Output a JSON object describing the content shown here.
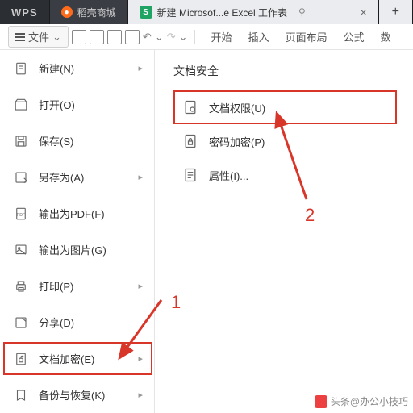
{
  "titlebar": {
    "wps": "WPS",
    "doko": "稻壳商城",
    "doc": "新建 Microsof...e Excel 工作表",
    "plus": "+"
  },
  "toolbar": {
    "file_label": "文件",
    "tabs": [
      "开始",
      "插入",
      "页面布局",
      "公式",
      "数"
    ]
  },
  "file_menu": [
    {
      "label": "新建(N)",
      "sub": true
    },
    {
      "label": "打开(O)"
    },
    {
      "label": "保存(S)"
    },
    {
      "label": "另存为(A)",
      "sub": true
    },
    {
      "label": "输出为PDF(F)"
    },
    {
      "label": "输出为图片(G)"
    },
    {
      "label": "打印(P)",
      "sub": true
    },
    {
      "label": "分享(D)"
    },
    {
      "label": "文档加密(E)",
      "sub": true,
      "hl": true
    },
    {
      "label": "备份与恢复(K)",
      "sub": true
    }
  ],
  "panel": {
    "title": "文档安全",
    "items": [
      {
        "label": "文档权限(U)",
        "hl": true
      },
      {
        "label": "密码加密(P)"
      },
      {
        "label": "属性(I)..."
      }
    ]
  },
  "annotations": {
    "step1": "1",
    "step2": "2"
  },
  "watermark": "头条@办公小技巧"
}
